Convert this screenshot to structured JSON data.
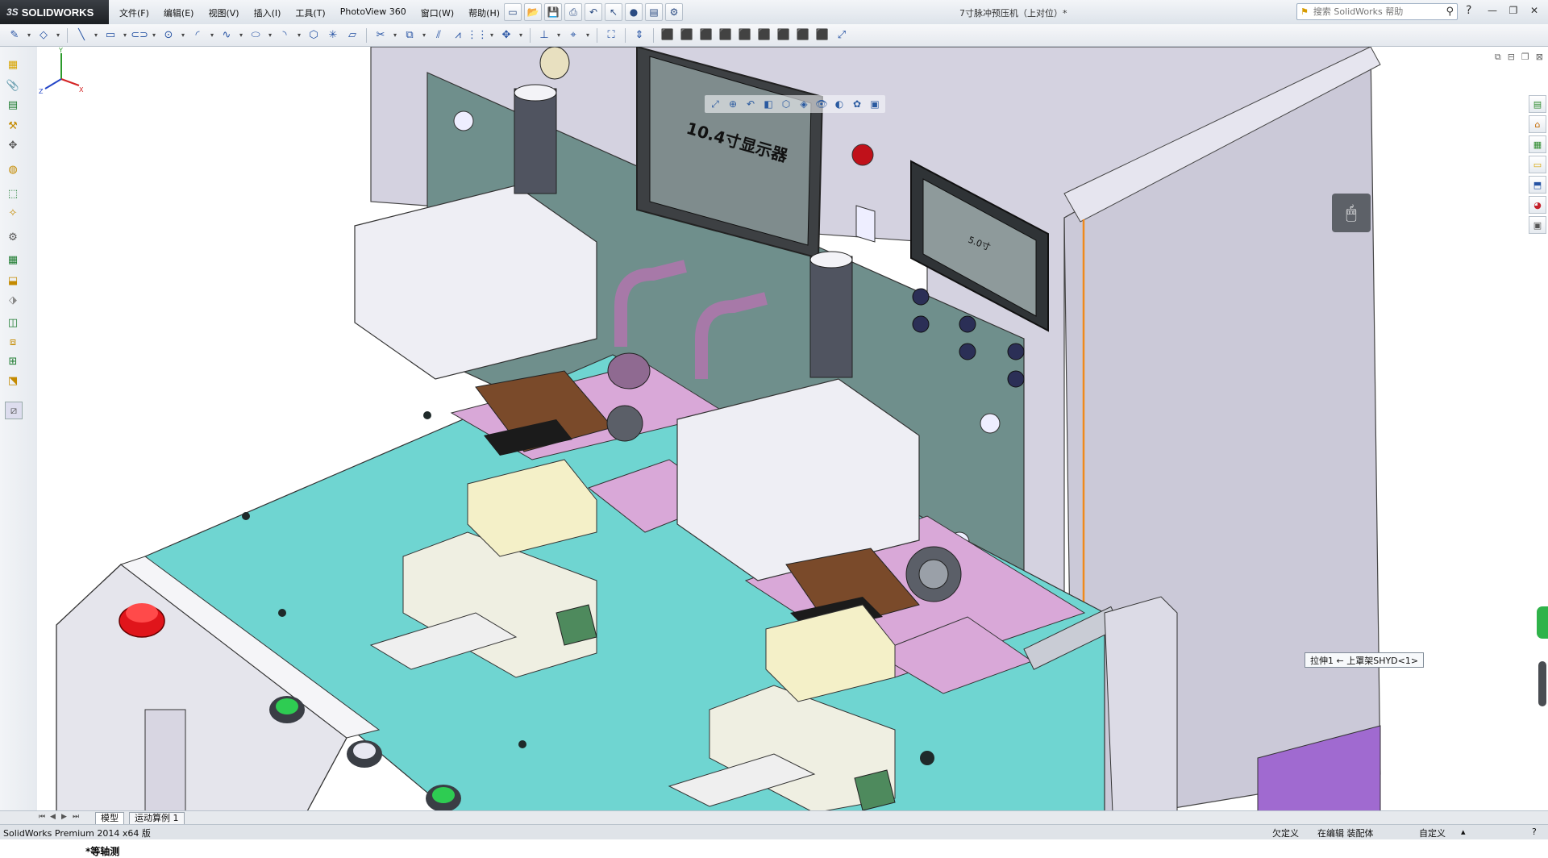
{
  "app": {
    "logo_ds": "3S",
    "logo_text": "SOLIDWORKS",
    "document_title": "7寸脉冲预压机（上对位）*"
  },
  "menu": [
    {
      "label": "文件(F)"
    },
    {
      "label": "编辑(E)"
    },
    {
      "label": "视图(V)"
    },
    {
      "label": "插入(I)"
    },
    {
      "label": "工具(T)"
    },
    {
      "label": "PhotoView 360"
    },
    {
      "label": "窗口(W)"
    },
    {
      "label": "帮助(H)"
    }
  ],
  "search": {
    "placeholder": "搜索 SolidWorks 帮助",
    "help_icon": "?"
  },
  "graphics": {
    "main_screen_text": "10.4寸显示器",
    "small_screen_text": "5.0寸",
    "tooltip": "拉伸1 ← 上罩架SHYD<1>",
    "view_orientation": "*等轴测"
  },
  "tabs": {
    "model": "模型",
    "motion": "运动算例 1"
  },
  "status": {
    "product": "SolidWorks Premium 2014 x64 版",
    "defined": "欠定义",
    "editing": "在编辑 装配体",
    "custom": "自定义"
  },
  "colors": {
    "base_plate": "#6fd5d1",
    "machine_body": "#d4d2e0",
    "back_panel": "#6f8f8c",
    "pink_parts": "#d9a8d8",
    "emergency_button": "#e0151b",
    "green_button": "#2ecc52",
    "accent_orange": "#f08a1c"
  },
  "icons": {
    "search": "magnifier-icon",
    "shortcut_box": "mouse-icon"
  }
}
